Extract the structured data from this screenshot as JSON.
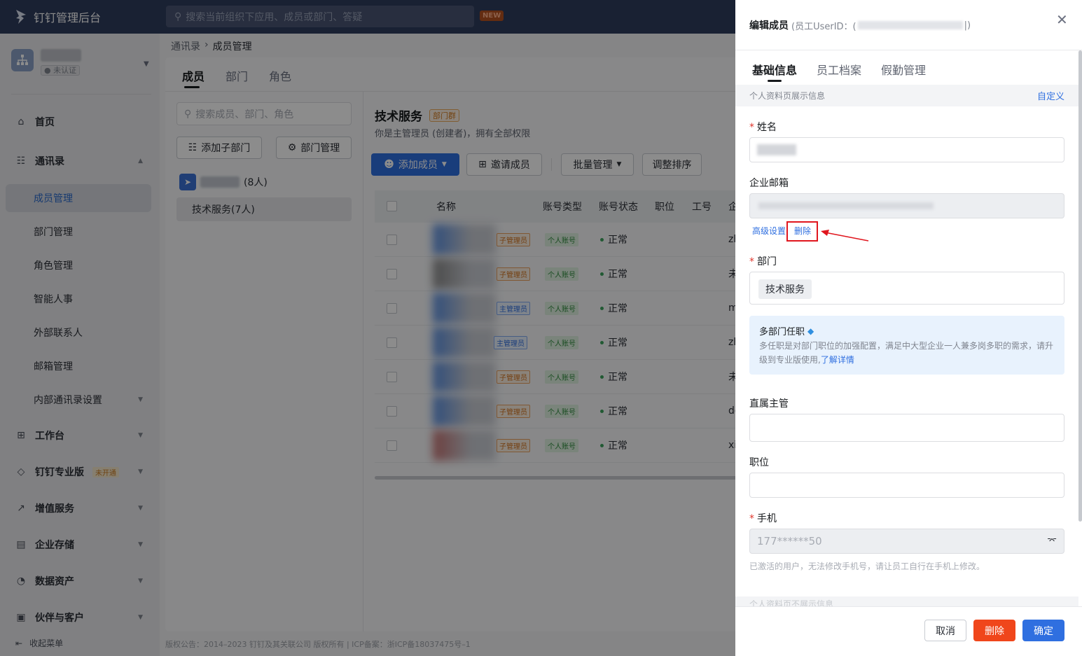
{
  "topbar": {
    "brand": "钉钉管理后台",
    "search_placeholder": "搜索当前组织下应用、成员或部门、答疑",
    "new_badge": "NEW"
  },
  "org": {
    "badge": "未认证"
  },
  "sidebar": {
    "home": "首页",
    "contacts": "通讯录",
    "sub_items": [
      "成员管理",
      "部门管理",
      "角色管理",
      "智能人事",
      "外部联系人",
      "邮箱管理",
      "内部通讯录设置"
    ],
    "workbench": "工作台",
    "pro": "钉钉专业版",
    "pro_tag": "未开通",
    "value_added": "增值服务",
    "storage": "企业存储",
    "data_assets": "数据资产",
    "partners": "伙伴与客户",
    "collapse": "收起菜单"
  },
  "breadcrumb": {
    "parent": "通讯录",
    "current": "成员管理"
  },
  "tabs": [
    "成员",
    "部门",
    "角色"
  ],
  "left_panel": {
    "search_placeholder": "搜索成员、部门、角色",
    "add_sub_dept": "添加子部门",
    "dept_manage": "部门管理",
    "root_count": "(8人)",
    "selected_dept": "技术服务(7人)"
  },
  "dept": {
    "title": "技术服务",
    "tag": "部门群",
    "desc": "你是主管理员 (创建者)，拥有全部权限",
    "add_member": "添加成员",
    "invite": "邀请成员",
    "batch": "批量管理",
    "sort": "调整排序"
  },
  "table": {
    "headers": [
      "名称",
      "账号类型",
      "账号状态",
      "职位",
      "工号",
      "企"
    ],
    "rows": [
      {
        "role": "子管理员",
        "role_type": "sub",
        "acct": "个人账号",
        "status": "正常",
        "email_prefix": "zh",
        "color": "#5b8fe0"
      },
      {
        "role": "子管理员",
        "role_type": "sub",
        "acct": "个人账号",
        "status": "正常",
        "email_prefix": "未",
        "color": "#8a8a8a"
      },
      {
        "role": "主管理员",
        "role_type": "main",
        "acct": "个人账号",
        "status": "正常",
        "email_prefix": "m",
        "color": "#5b8fe0"
      },
      {
        "role": "主管理员",
        "role_type": "main",
        "acct": "个人账号",
        "status": "正常",
        "email_prefix": "zh",
        "color": "#5b8fe0"
      },
      {
        "role": "子管理员",
        "role_type": "sub",
        "acct": "个人账号",
        "status": "正常",
        "email_prefix": "未",
        "color": "#5b8fe0"
      },
      {
        "role": "子管理员",
        "role_type": "sub",
        "acct": "个人账号",
        "status": "正常",
        "email_prefix": "dd",
        "color": "#5b8fe0"
      },
      {
        "role": "子管理员",
        "role_type": "sub",
        "acct": "个人账号",
        "status": "正常",
        "email_prefix": "xi",
        "color": "#c67373"
      }
    ]
  },
  "footer": "版权公告：2014–2023 钉钉及其关联公司 版权所有 | ICP备案：浙ICP备18037475号–1",
  "drawer": {
    "title": "编辑成员",
    "uid_prefix": "(员工UserID：(",
    "uid_suffix": "|)",
    "tabs": [
      "基础信息",
      "员工档案",
      "假勤管理"
    ],
    "section": "个人资料页展示信息",
    "customize": "自定义",
    "name_label": "姓名",
    "email_label": "企业邮箱",
    "advanced": "高级设置",
    "delete_email": "删除",
    "dept_label": "部门",
    "dept_chip": "技术服务",
    "multi_title": "多部门任职",
    "multi_desc": "多任职是对部门职位的加强配置，满足中大型企业一人兼多岗多职的需求，请升级到专业版使用,",
    "multi_link": "了解详情",
    "manager_label": "直属主管",
    "position_label": "职位",
    "phone_label": "手机",
    "phone_value": "177******50",
    "phone_hint": "已激活的用户，无法修改手机号，请让员工自行在手机上修改。",
    "section2": "个人资料页不展示信息",
    "cancel": "取消",
    "delete": "删除",
    "confirm": "确定"
  }
}
